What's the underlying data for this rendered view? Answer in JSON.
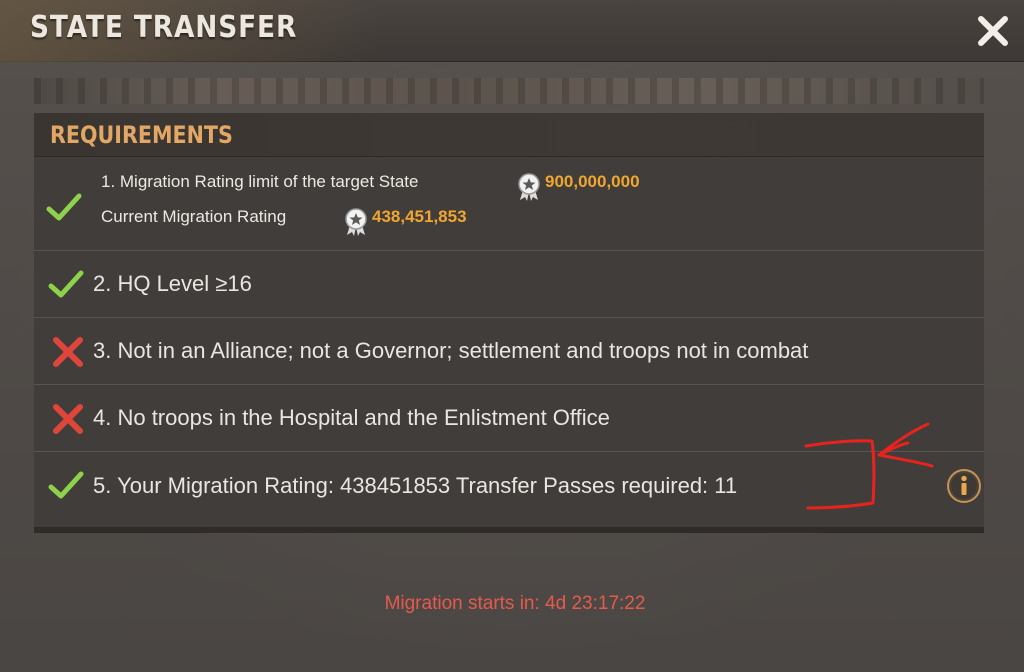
{
  "window": {
    "title": "STATE TRANSFER",
    "close_icon": "close-icon"
  },
  "requirements": {
    "header": "REQUIREMENTS",
    "items": [
      {
        "status": "met",
        "line1_label": "1. Migration Rating limit of the target State",
        "line1_value": "900,000,000",
        "line2_label": "Current Migration Rating",
        "line2_value": "438,451,853",
        "icon": "medal-icon"
      },
      {
        "status": "met",
        "label": "2. HQ Level ≥16"
      },
      {
        "status": "unmet",
        "label": "3. Not in an Alliance; not a Governor; settlement and troops not in combat"
      },
      {
        "status": "unmet",
        "label": "4. No troops in the Hospital and the Enlistment Office"
      },
      {
        "status": "met",
        "label": "5. Your Migration Rating: 438451853 Transfer Passes required: 11",
        "info_icon": "info-icon"
      }
    ]
  },
  "countdown": "Migration starts in: 4d 23:17:22",
  "colors": {
    "accent_orange": "#e3a765",
    "rating_gold": "#f0a630",
    "check_green": "#8ed14a",
    "cross_red": "#e0453a",
    "countdown_red": "#e65a4e",
    "annotation_red": "#e8231e"
  }
}
